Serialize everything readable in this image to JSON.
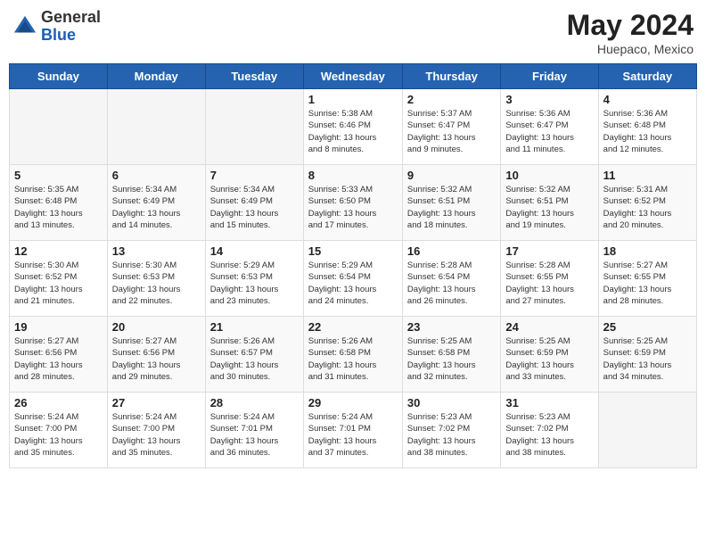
{
  "header": {
    "logo_general": "General",
    "logo_blue": "Blue",
    "month_title": "May 2024",
    "location": "Huepaco, Mexico"
  },
  "weekdays": [
    "Sunday",
    "Monday",
    "Tuesday",
    "Wednesday",
    "Thursday",
    "Friday",
    "Saturday"
  ],
  "weeks": [
    [
      {
        "day": "",
        "info": ""
      },
      {
        "day": "",
        "info": ""
      },
      {
        "day": "",
        "info": ""
      },
      {
        "day": "1",
        "info": "Sunrise: 5:38 AM\nSunset: 6:46 PM\nDaylight: 13 hours\nand 8 minutes."
      },
      {
        "day": "2",
        "info": "Sunrise: 5:37 AM\nSunset: 6:47 PM\nDaylight: 13 hours\nand 9 minutes."
      },
      {
        "day": "3",
        "info": "Sunrise: 5:36 AM\nSunset: 6:47 PM\nDaylight: 13 hours\nand 11 minutes."
      },
      {
        "day": "4",
        "info": "Sunrise: 5:36 AM\nSunset: 6:48 PM\nDaylight: 13 hours\nand 12 minutes."
      }
    ],
    [
      {
        "day": "5",
        "info": "Sunrise: 5:35 AM\nSunset: 6:48 PM\nDaylight: 13 hours\nand 13 minutes."
      },
      {
        "day": "6",
        "info": "Sunrise: 5:34 AM\nSunset: 6:49 PM\nDaylight: 13 hours\nand 14 minutes."
      },
      {
        "day": "7",
        "info": "Sunrise: 5:34 AM\nSunset: 6:49 PM\nDaylight: 13 hours\nand 15 minutes."
      },
      {
        "day": "8",
        "info": "Sunrise: 5:33 AM\nSunset: 6:50 PM\nDaylight: 13 hours\nand 17 minutes."
      },
      {
        "day": "9",
        "info": "Sunrise: 5:32 AM\nSunset: 6:51 PM\nDaylight: 13 hours\nand 18 minutes."
      },
      {
        "day": "10",
        "info": "Sunrise: 5:32 AM\nSunset: 6:51 PM\nDaylight: 13 hours\nand 19 minutes."
      },
      {
        "day": "11",
        "info": "Sunrise: 5:31 AM\nSunset: 6:52 PM\nDaylight: 13 hours\nand 20 minutes."
      }
    ],
    [
      {
        "day": "12",
        "info": "Sunrise: 5:30 AM\nSunset: 6:52 PM\nDaylight: 13 hours\nand 21 minutes."
      },
      {
        "day": "13",
        "info": "Sunrise: 5:30 AM\nSunset: 6:53 PM\nDaylight: 13 hours\nand 22 minutes."
      },
      {
        "day": "14",
        "info": "Sunrise: 5:29 AM\nSunset: 6:53 PM\nDaylight: 13 hours\nand 23 minutes."
      },
      {
        "day": "15",
        "info": "Sunrise: 5:29 AM\nSunset: 6:54 PM\nDaylight: 13 hours\nand 24 minutes."
      },
      {
        "day": "16",
        "info": "Sunrise: 5:28 AM\nSunset: 6:54 PM\nDaylight: 13 hours\nand 26 minutes."
      },
      {
        "day": "17",
        "info": "Sunrise: 5:28 AM\nSunset: 6:55 PM\nDaylight: 13 hours\nand 27 minutes."
      },
      {
        "day": "18",
        "info": "Sunrise: 5:27 AM\nSunset: 6:55 PM\nDaylight: 13 hours\nand 28 minutes."
      }
    ],
    [
      {
        "day": "19",
        "info": "Sunrise: 5:27 AM\nSunset: 6:56 PM\nDaylight: 13 hours\nand 28 minutes."
      },
      {
        "day": "20",
        "info": "Sunrise: 5:27 AM\nSunset: 6:56 PM\nDaylight: 13 hours\nand 29 minutes."
      },
      {
        "day": "21",
        "info": "Sunrise: 5:26 AM\nSunset: 6:57 PM\nDaylight: 13 hours\nand 30 minutes."
      },
      {
        "day": "22",
        "info": "Sunrise: 5:26 AM\nSunset: 6:58 PM\nDaylight: 13 hours\nand 31 minutes."
      },
      {
        "day": "23",
        "info": "Sunrise: 5:25 AM\nSunset: 6:58 PM\nDaylight: 13 hours\nand 32 minutes."
      },
      {
        "day": "24",
        "info": "Sunrise: 5:25 AM\nSunset: 6:59 PM\nDaylight: 13 hours\nand 33 minutes."
      },
      {
        "day": "25",
        "info": "Sunrise: 5:25 AM\nSunset: 6:59 PM\nDaylight: 13 hours\nand 34 minutes."
      }
    ],
    [
      {
        "day": "26",
        "info": "Sunrise: 5:24 AM\nSunset: 7:00 PM\nDaylight: 13 hours\nand 35 minutes."
      },
      {
        "day": "27",
        "info": "Sunrise: 5:24 AM\nSunset: 7:00 PM\nDaylight: 13 hours\nand 35 minutes."
      },
      {
        "day": "28",
        "info": "Sunrise: 5:24 AM\nSunset: 7:01 PM\nDaylight: 13 hours\nand 36 minutes."
      },
      {
        "day": "29",
        "info": "Sunrise: 5:24 AM\nSunset: 7:01 PM\nDaylight: 13 hours\nand 37 minutes."
      },
      {
        "day": "30",
        "info": "Sunrise: 5:23 AM\nSunset: 7:02 PM\nDaylight: 13 hours\nand 38 minutes."
      },
      {
        "day": "31",
        "info": "Sunrise: 5:23 AM\nSunset: 7:02 PM\nDaylight: 13 hours\nand 38 minutes."
      },
      {
        "day": "",
        "info": ""
      }
    ]
  ]
}
